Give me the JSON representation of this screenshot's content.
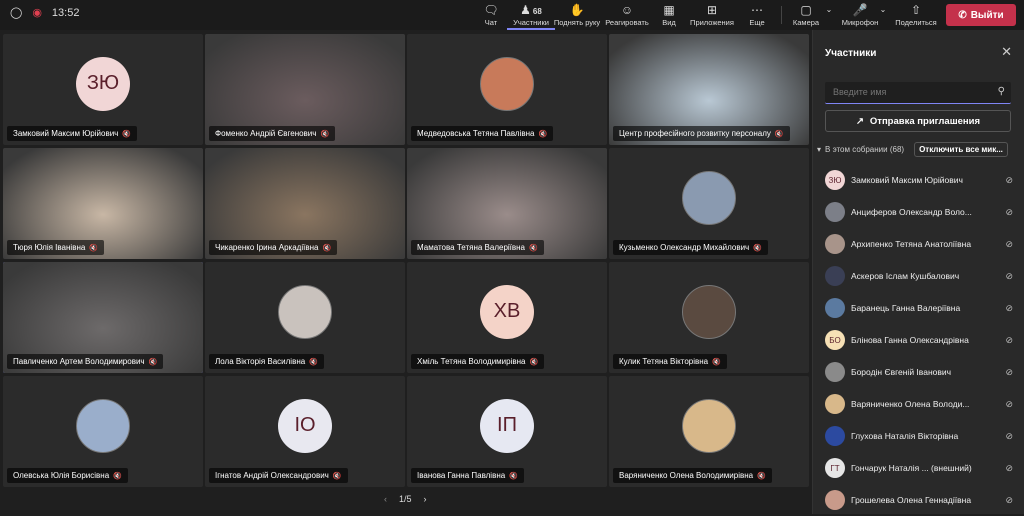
{
  "topbar": {
    "time": "13:52",
    "participants_count": "68",
    "buttons": [
      {
        "label": "Чат",
        "icon": "chat-icon"
      },
      {
        "label": "Участники",
        "icon": "people-icon"
      },
      {
        "label": "Поднять руку",
        "icon": "raise-hand-icon"
      },
      {
        "label": "Реагировать",
        "icon": "react-icon"
      },
      {
        "label": "Вид",
        "icon": "view-icon"
      },
      {
        "label": "Приложения",
        "icon": "apps-icon"
      },
      {
        "label": "Еще",
        "icon": "more-icon"
      },
      {
        "label": "Камера",
        "icon": "camera-icon"
      },
      {
        "label": "Микрофон",
        "icon": "microphone-icon"
      },
      {
        "label": "Поделиться",
        "icon": "share-icon"
      }
    ],
    "leave_label": "Выйти"
  },
  "tiles": [
    {
      "name": "Замковий Максим Юрійович",
      "initials": "ЗЮ",
      "type": "initials",
      "color": "#f1d6d6"
    },
    {
      "name": "Фоменко Андрій Євгенович",
      "initials": "",
      "type": "video",
      "color": "#6b5c5e"
    },
    {
      "name": "Медведовська Тетяна Павлівна",
      "initials": "",
      "type": "photo",
      "color": "#c87a5a"
    },
    {
      "name": "Центр професійного розвитку персоналу",
      "initials": "",
      "type": "video",
      "color": "#b9c8d4"
    },
    {
      "name": "Тюря Юлія Іванівна",
      "initials": "",
      "type": "video",
      "color": "#c8b7a5"
    },
    {
      "name": "Чикаренко Ірина Аркадіївна",
      "initials": "",
      "type": "video",
      "color": "#8a7560"
    },
    {
      "name": "Маматова Тетяна Валеріївна",
      "initials": "",
      "type": "video",
      "color": "#9a8c8a"
    },
    {
      "name": "Кузьменко Олександр Михайлович",
      "initials": "",
      "type": "photo",
      "color": "#8a9ab0"
    },
    {
      "name": "Павличенко Артем Володимирович",
      "initials": "",
      "type": "video",
      "color": "#6d6a6a"
    },
    {
      "name": "Лола Вікторія Василівна",
      "initials": "",
      "type": "photo",
      "color": "#c9c2bd"
    },
    {
      "name": "Хміль Тетяна Володимирівна",
      "initials": "ХВ",
      "type": "initials",
      "color": "#f4d3c8"
    },
    {
      "name": "Кулик Тетяна Вікторівна",
      "initials": "",
      "type": "photo",
      "color": "#5a4a40"
    },
    {
      "name": "Олевська Юлія Борисівна",
      "initials": "",
      "type": "photo",
      "color": "#9aaecb"
    },
    {
      "name": "Ігнатов Андрій Олександрович",
      "initials": "ІО",
      "type": "initials",
      "color": "#e8e8f0"
    },
    {
      "name": "Іванова Ганна Павлівна",
      "initials": "ІП",
      "type": "initials",
      "color": "#e6e8f2"
    },
    {
      "name": "Варяниченко Олена Володимирівна",
      "initials": "",
      "type": "photo",
      "color": "#d8b88a"
    }
  ],
  "pager": {
    "text": "1/5",
    "prev": "‹",
    "next": "›"
  },
  "panel": {
    "title": "Участники",
    "search_placeholder": "Введите имя",
    "invite_label": "Отправка приглашения",
    "section_label": "В этом собрании (68)",
    "mute_all_label": "Отключить все мик...",
    "participants": [
      {
        "name": "Замковий Максим Юрійович",
        "initials": "ЗЮ",
        "color": "#f1d6d6"
      },
      {
        "name": "Анциферов Олександр Воло...",
        "initials": "",
        "color": "#7c7f88"
      },
      {
        "name": "Архипенко Тетяна Анатоліївна",
        "initials": "",
        "color": "#a8948a"
      },
      {
        "name": "Аскеров Іслам Кушбалович",
        "initials": "",
        "color": "#3a3f55"
      },
      {
        "name": "Баранець Ганна Валеріївна",
        "initials": "",
        "color": "#5b7aa0"
      },
      {
        "name": "Блінова Ганна Олександрівна",
        "initials": "БО",
        "color": "#f6e0b5"
      },
      {
        "name": "Бородін Євгеній Іванович",
        "initials": "",
        "color": "#8a8a8a"
      },
      {
        "name": "Варяниченко Олена Володи...",
        "initials": "",
        "color": "#d8b88a"
      },
      {
        "name": "Глухова Наталія Вікторівна",
        "initials": "",
        "color": "#2c4aa0"
      },
      {
        "name": "Гончарук Наталія ... (внешний)",
        "initials": "ГТ",
        "color": "#e6e6e6"
      },
      {
        "name": "Грошелева Олена Геннадіївна",
        "initials": "",
        "color": "#c89a8a"
      }
    ]
  }
}
